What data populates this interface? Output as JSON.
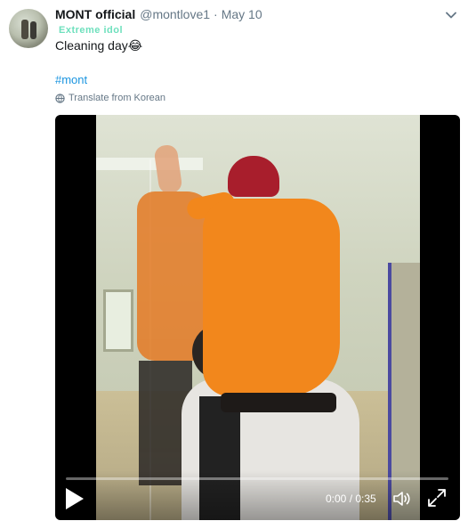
{
  "tweet": {
    "author_name": "MONT official",
    "handle": "@montlove1",
    "separator": "·",
    "date": "May 10",
    "badge_text": "Extreme idol",
    "text": "Cleaning day😂",
    "hashtag": "#mont",
    "translate_label": "Translate from Korean"
  },
  "video": {
    "time_display": "0:00 / 0:35",
    "progress_fraction": 0.0
  },
  "icons": {
    "more": "chevron-down-icon",
    "translate": "globe-icon",
    "play": "play-icon",
    "volume": "volume-icon",
    "fullscreen": "expand-icon"
  },
  "colors": {
    "link": "#1b95e0",
    "muted": "#657786",
    "badge": "#6ee0bd"
  }
}
